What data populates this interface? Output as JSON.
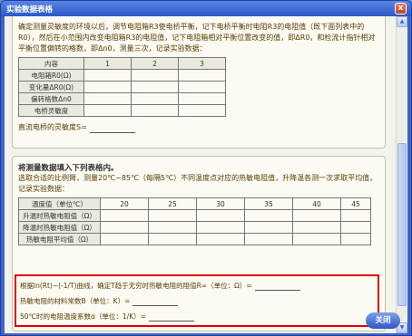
{
  "window": {
    "title": "实验数据表格",
    "close_glyph": "x"
  },
  "top": {
    "paragraph": "确定测量灵敏度的环境以后，调节电阻箱R3使电桥平衡，记下电桥平衡时电阻R3的电阻值（既下面列表中的R0），然后在小范围内改变电阻箱R3的电阻值，记下电阻箱相对平衡位置改变的值，即ΔR0，和检流计指针相对平衡位置偏转的格数，即Δn0，测量三次，记录实验数据：",
    "table": {
      "header": [
        "内容",
        "1",
        "2",
        "3"
      ],
      "rows": [
        "电阻箱R0(Ω)",
        "变化量ΔR0(Ω)",
        "偏转格数Δn0",
        "电桥灵敏度"
      ]
    },
    "sensitivity_label": "直流电桥的灵敏度S="
  },
  "bottom": {
    "title": "将测量数据填入下列表格内。",
    "paragraph": "选取合适的比例臂，测量20℃~85℃（每隔5℃）不同温度点对应的热敏电阻值，升降温各测一次求取平均值，记录实验数据：",
    "table": {
      "header": [
        "温度值（单位℃）",
        "20",
        "25",
        "30",
        "35",
        "40",
        "45"
      ],
      "rows": [
        "升温时热敏电阻值（Ω）",
        "降温时热敏电阻值（Ω）",
        "热敏电阻平均值（Ω）"
      ]
    },
    "results": {
      "line1": "根据ln(Rt)~(-1/T)曲线，确定T趋于无穷时热敏电阻的阻值R∞（单位：Ω）=",
      "line2": "热敏电阻的材料常数B（单位：K）=",
      "line3": "50℃时的电阻温度系数α（单位：1/K）="
    }
  },
  "close_button": "关闭",
  "colors": {
    "accent": "#3d64c9",
    "highlight": "#e00000",
    "text": "#5a3a00"
  }
}
